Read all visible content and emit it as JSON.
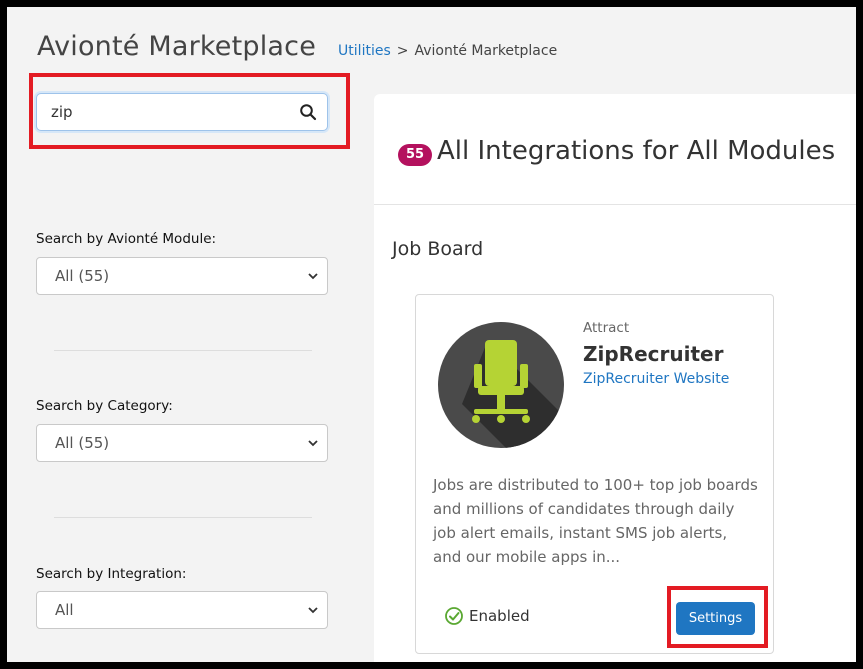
{
  "header": {
    "title": "Avionté Marketplace",
    "breadcrumb": {
      "link": "Utilities",
      "separator": ">",
      "current": "Avionté Marketplace"
    }
  },
  "search": {
    "value": "zip",
    "placeholder": "",
    "icon": "search-icon"
  },
  "filters": {
    "module": {
      "label": "Search by Avionté Module:",
      "selected": "All (55)"
    },
    "category": {
      "label": "Search by Category:",
      "selected": "All (55)"
    },
    "integration": {
      "label": "Search by Integration:",
      "selected": "All"
    }
  },
  "main": {
    "count": "55",
    "title": "All Integrations for All Modules",
    "group": "Job Board",
    "card": {
      "category": "Attract",
      "name": "ZipRecruiter",
      "link": "ZipRecruiter Website",
      "description": "Jobs are distributed to 100+ top job boards and millions of candidates through daily job alert emails, instant SMS job alerts, and our mobile apps in...",
      "status": "Enabled",
      "settings_label": "Settings"
    }
  },
  "colors": {
    "accent": "#1f76c2",
    "badge": "#b4115e",
    "highlight": "#e31b23",
    "logo_green": "#b5d334",
    "logo_bg": "#4a4a4a",
    "enabled": "#5aa832"
  }
}
